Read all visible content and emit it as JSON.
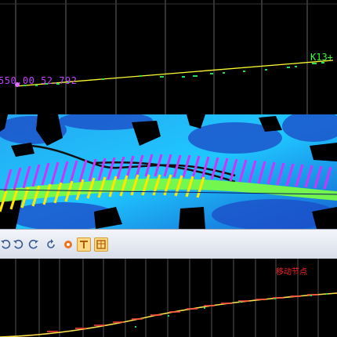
{
  "plan_view": {
    "start_station_label": "550.00 52.792",
    "end_station_label": "K13+"
  },
  "toolbar": {
    "buttons": [
      {
        "icon": "rotate-left-icon"
      },
      {
        "icon": "rotate-ccw-icon"
      },
      {
        "icon": "rotate-cw-icon"
      },
      {
        "icon": "refresh-icon"
      },
      {
        "icon": "settings-icon"
      },
      {
        "icon": "text-tool-icon",
        "active": true
      },
      {
        "icon": "table-tool-icon",
        "active": true
      }
    ]
  },
  "profile_view": {
    "action_label": "移动节点"
  },
  "colors": {
    "alignment_line": "#ffff33",
    "profile_line": "#ffe24a",
    "start_label": "#c040ff",
    "end_label": "#37ff37",
    "profile_text": "#ff2020"
  }
}
